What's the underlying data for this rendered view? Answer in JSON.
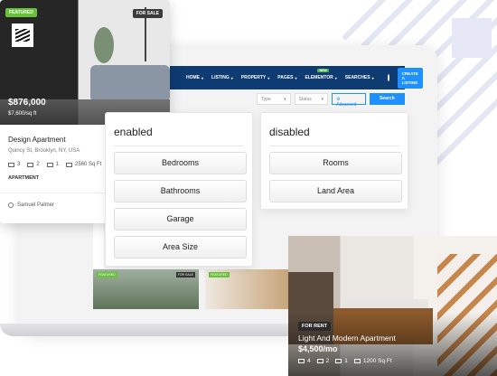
{
  "nav": {
    "items": [
      {
        "label": "HOME",
        "new": ""
      },
      {
        "label": "LISTING",
        "new": ""
      },
      {
        "label": "PROPERTY",
        "new": ""
      },
      {
        "label": "PAGES",
        "new": ""
      },
      {
        "label": "ELEMENTOR",
        "new": "NEW"
      },
      {
        "label": "SEARCHES",
        "new": ""
      }
    ],
    "create_listing": "CREATE A LISTING"
  },
  "search": {
    "type": "Type",
    "status": "Status",
    "advanced": "Advanced",
    "search_btn": "Search"
  },
  "featured_card": {
    "badge_featured": "FEATURED",
    "badge_sale": "FOR SALE",
    "price": "$876,000",
    "price_per": "$7,600/sq ft",
    "title": "Design Apartment",
    "address": "Quincy St, Brooklyn, NY, USA",
    "beds": "3",
    "baths": "2",
    "garage": "1",
    "area": "2560 Sq Ft",
    "type": "APARTMENT",
    "agent": "Samuel Palmer"
  },
  "enabled_panel": {
    "title": "enabled",
    "buttons": [
      "Bedrooms",
      "Bathrooms",
      "Garage",
      "Area Size"
    ]
  },
  "disabled_panel": {
    "title": "disabled",
    "buttons": [
      "Rooms",
      "Land Area"
    ]
  },
  "rent_card": {
    "badge": "FOR RENT",
    "title": "Light And Modern Apartment",
    "price": "$4,500/mo",
    "beds": "4",
    "baths": "2",
    "garage": "1",
    "area": "1200 Sq Ft"
  },
  "mini_cards": {
    "sale_badge": "FOR SALE",
    "featured_badge": "FEATURED"
  },
  "colors": {
    "nav_bg": "#0f3b73",
    "accent": "#1e90ff",
    "featured": "#67c23a"
  }
}
